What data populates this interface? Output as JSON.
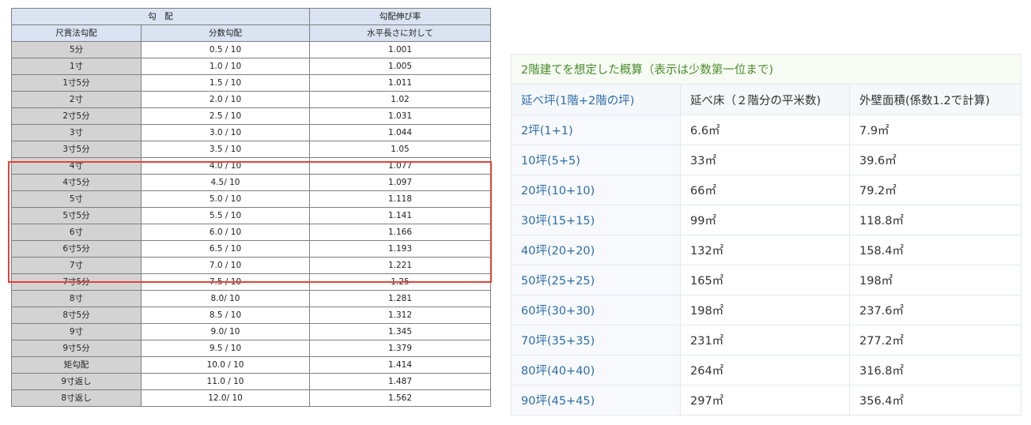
{
  "slope_table": {
    "header_group_1": "勾　配",
    "header_group_2": "勾配伸び率",
    "col_headers": [
      "尺貫法勾配",
      "分数勾配",
      "水平長さに対して"
    ],
    "rows": [
      [
        "5分",
        "0.5 / 10",
        "1.001"
      ],
      [
        "1寸",
        "1.0 / 10",
        "1.005"
      ],
      [
        "1寸5分",
        "1.5 / 10",
        "1.011"
      ],
      [
        "2寸",
        "2.0 / 10",
        "1.02"
      ],
      [
        "2寸5分",
        "2.5 / 10",
        "1.031"
      ],
      [
        "3寸",
        "3.0 / 10",
        "1.044"
      ],
      [
        "3寸5分",
        "3.5 / 10",
        "1.05"
      ],
      [
        "4寸",
        "4.0 / 10",
        "1.077"
      ],
      [
        "4寸5分",
        "4.5/ 10",
        "1.097"
      ],
      [
        "5寸",
        "5.0 / 10",
        "1.118"
      ],
      [
        "5寸5分",
        "5.5 / 10",
        "1.141"
      ],
      [
        "6寸",
        "6.0 / 10",
        "1.166"
      ],
      [
        "6寸5分",
        "6.5 / 10",
        "1.193"
      ],
      [
        "7寸",
        "7.0 / 10",
        "1.221"
      ],
      [
        "7寸5分",
        "7.5 / 10",
        "1.25"
      ],
      [
        "8寸",
        "8.0/ 10",
        "1.281"
      ],
      [
        "8寸5分",
        "8.5 / 10",
        "1.312"
      ],
      [
        "9寸",
        "9.0/ 10",
        "1.345"
      ],
      [
        "9寸5分",
        "9.5 / 10",
        "1.379"
      ],
      [
        "矩勾配",
        "10.0 / 10",
        "1.414"
      ],
      [
        "9寸返し",
        "11.0 / 10",
        "1.487"
      ],
      [
        "8寸返し",
        "12.0/ 10",
        "1.562"
      ]
    ],
    "highlight_color": "#e04438",
    "header_bg": "#d9e3f1",
    "rowhead_bg": "#d3d3d3"
  },
  "estimate_table": {
    "caption": "2階建てを想定した概算（表示は少数第一位まで)",
    "headers": [
      "延べ坪(1階+2階の坪)",
      "延べ床（２階分の平米数)",
      "外壁面積(係数1.2で計算)"
    ],
    "rows": [
      [
        "2坪(1+1)",
        "6.6㎡",
        "7.9㎡"
      ],
      [
        "10坪(5+5)",
        "33㎡",
        "39.6㎡"
      ],
      [
        "20坪(10+10)",
        "66㎡",
        "79.2㎡"
      ],
      [
        "30坪(15+15)",
        "99㎡",
        "118.8㎡"
      ],
      [
        "40坪(20+20)",
        "132㎡",
        "158.4㎡"
      ],
      [
        "50坪(25+25)",
        "165㎡",
        "198㎡"
      ],
      [
        "60坪(30+30)",
        "198㎡",
        "237.6㎡"
      ],
      [
        "70坪(35+35)",
        "231㎡",
        "277.2㎡"
      ],
      [
        "80坪(40+40)",
        "264㎡",
        "316.8㎡"
      ],
      [
        "90坪(45+45)",
        "297㎡",
        "356.4㎡"
      ]
    ],
    "caption_color": "#4a8d2c",
    "link_color": "#2e6da8"
  }
}
